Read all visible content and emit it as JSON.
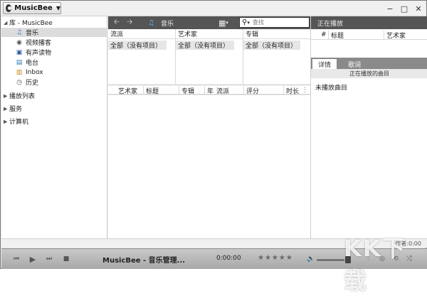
{
  "app": {
    "title": "MusicBee"
  },
  "window_controls": [
    "−",
    "□",
    "✕"
  ],
  "sidebar": {
    "library_label": "库 - MusicBee",
    "items": [
      {
        "label": "音乐",
        "icon": "music-note-icon"
      },
      {
        "label": "视频播客",
        "icon": "video-icon"
      },
      {
        "label": "有声读物",
        "icon": "audiobook-icon"
      },
      {
        "label": "电台",
        "icon": "radio-icon"
      },
      {
        "label": "Inbox",
        "icon": "inbox-icon"
      },
      {
        "label": "历史",
        "icon": "clock-icon"
      }
    ],
    "sections": [
      "播放列表",
      "服务",
      "计算机"
    ]
  },
  "navbar": {
    "location": "音乐"
  },
  "search": {
    "placeholder": "查找"
  },
  "browser": {
    "panes": [
      {
        "header": "流派",
        "value": "全部（没有项目）"
      },
      {
        "header": "艺术家",
        "value": "全部（没有项目）"
      },
      {
        "header": "专辑",
        "value": "全部（没有项目）"
      }
    ]
  },
  "tracklist": {
    "columns": [
      "艺术家",
      "标题",
      "专辑",
      "年",
      "流派",
      "评分",
      "时长"
    ]
  },
  "now_playing_panel": {
    "title": "正在播放",
    "columns": [
      "#",
      "标题",
      "艺术家"
    ],
    "tabs": [
      "详情",
      "歌词"
    ],
    "subheader": "正在播放的曲目",
    "empty_text": "未播放曲目"
  },
  "status": {
    "right": "作者:0:00"
  },
  "player": {
    "now_playing": "MusicBee - 音乐管理...",
    "time": "0:00:00",
    "rating": "★★★★★",
    "volume_fraction": 0.9
  },
  "watermark": "KK下载",
  "colors": {
    "dark_bar": "#555555",
    "selected": "#dcdcdc"
  }
}
